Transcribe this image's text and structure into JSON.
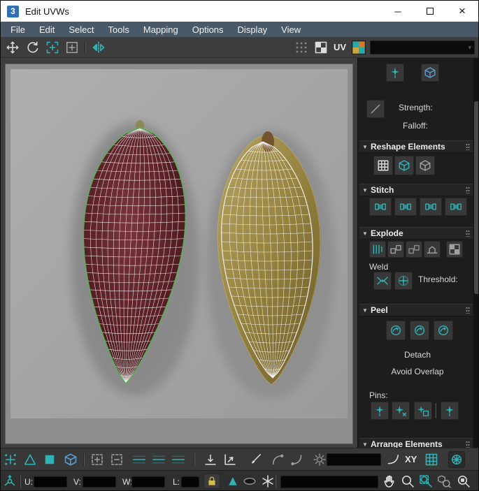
{
  "window": {
    "title": "Edit UVWs",
    "logo_text": "3",
    "minimize_glyph": "─",
    "close_glyph": "×"
  },
  "menu": {
    "items": [
      "File",
      "Edit",
      "Select",
      "Tools",
      "Mapping",
      "Options",
      "Display",
      "View"
    ]
  },
  "top_toolbar": {
    "uv_label": "UV",
    "texture_dropdown_value": ""
  },
  "right_panel": {
    "paint": {
      "strength_label": "Strength:",
      "falloff_label": "Falloff:"
    },
    "sections": {
      "reshape": {
        "title": "Reshape Elements"
      },
      "stitch": {
        "title": "Stitch"
      },
      "explode": {
        "title": "Explode",
        "weld_label": "Weld",
        "threshold_label": "Threshold:"
      },
      "peel": {
        "title": "Peel",
        "detach_label": "Detach",
        "avoid_overlap_label": "Avoid Overlap",
        "pins_label": "Pins:"
      },
      "arrange": {
        "title": "Arrange Elements"
      }
    }
  },
  "bottom_toolbar": {
    "xy_label": "XY",
    "value_field": ""
  },
  "status_bar": {
    "u_label": "U:",
    "u_value": "",
    "v_label": "V:",
    "v_value": "",
    "w_label": "W:",
    "w_value": "",
    "l_label": "L:",
    "l_value": "",
    "prompt": ""
  },
  "colors": {
    "accent_teal": "#2fb3b6",
    "selection_green": "#55b055",
    "menubar_blue": "#4a5968",
    "seed_left_fill": "#592026",
    "seed_right_fill": "#95823f",
    "viewport_gray": "#a6a6a6"
  },
  "icons": {
    "top_toolbar": [
      "move-tool-icon",
      "rotate-tool-icon",
      "freeform-mode-icon",
      "zoom-region-tool-icon",
      "mirror-icon",
      "snap-grid-icon",
      "checker-pattern-icon",
      "uv-checker-icon"
    ],
    "right_panel": [
      "paint-brush-icon",
      "relax-brush-icon",
      "falloff-curve-icon",
      "relax-grid-icon",
      "reshape-cube-icon",
      "reshape-cube-alt-icon",
      "stitch-custom-icon",
      "stitch-average-icon",
      "stitch-source-icon",
      "stitch-target-icon",
      "explode-columns-icon",
      "explode-groups-icon",
      "explode-objects-icon",
      "flatten-icon",
      "flatten-checker-icon",
      "weld-selected-icon",
      "target-weld-icon",
      "quick-peel-icon",
      "peel-mode-icon",
      "edit-seams-icon",
      "pin-icon",
      "unpin-icon",
      "pin-region-icon",
      "pin-tool-icon"
    ],
    "bottom_toolbar": [
      "vertex-mode-icon",
      "edge-mode-icon",
      "polygon-mode-icon",
      "element-mode-icon",
      "grow-selection-icon",
      "shrink-selection-icon",
      "select-loop-icon",
      "select-ring-icon",
      "select-gap-icon",
      "align-bottom-icon",
      "align-corner-icon",
      "paint-select-icon",
      "falloff-hook-icon",
      "falloff-hook-alt-icon",
      "options-gear-icon",
      "smooth-curve-icon",
      "grid-snap-icon",
      "uvw-gizmo-icon"
    ],
    "status_bar": [
      "axis-gizmo-icon",
      "lock-selection-icon",
      "relative-mode-icon",
      "shaded-toggle-icon",
      "freeze-icon",
      "pan-hand-icon",
      "zoom-icon",
      "zoom-region-icon",
      "zoom-extents-icon",
      "zoom-selected-icon"
    ]
  }
}
